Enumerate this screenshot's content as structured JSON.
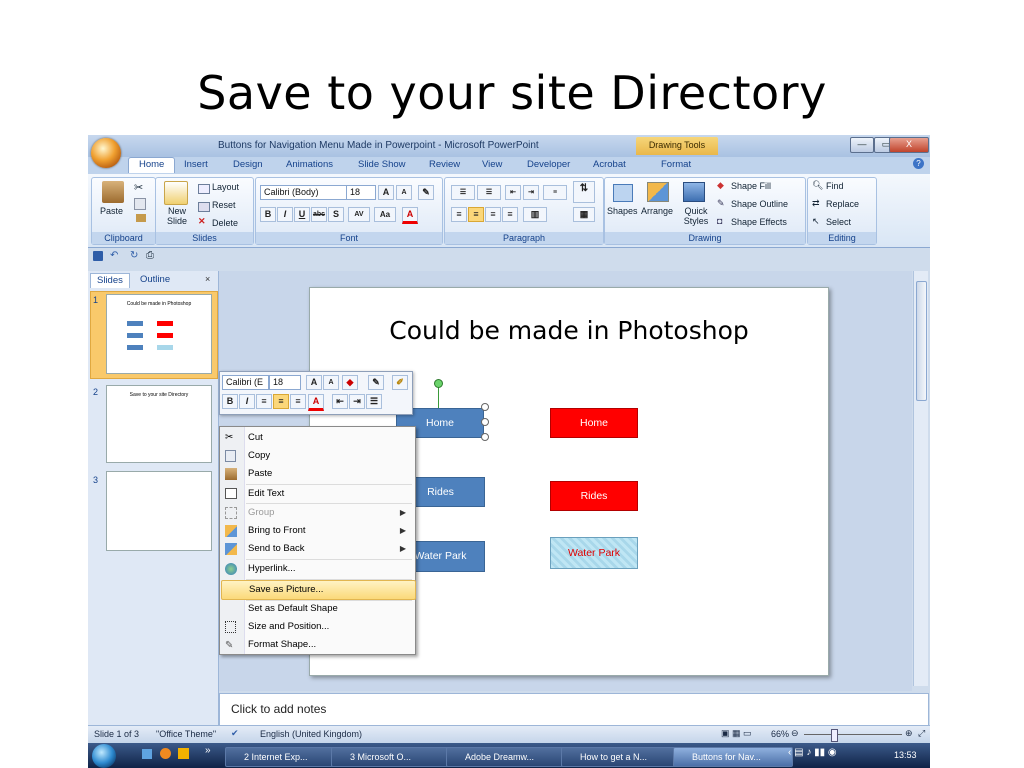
{
  "heading": "Save to your site Directory",
  "window": {
    "title": "Buttons for Navigation  Menu Made in Powerpoint - Microsoft PowerPoint",
    "contextual_tab": "Drawing Tools",
    "controls": [
      "—",
      "▭",
      "X"
    ]
  },
  "tabs": [
    "Home",
    "Insert",
    "Design",
    "Animations",
    "Slide Show",
    "Review",
    "View",
    "Developer",
    "Acrobat",
    "Format"
  ],
  "ribbon": {
    "clipboard": {
      "label": "Clipboard",
      "paste": "Paste"
    },
    "slides": {
      "label": "Slides",
      "new_slide": "New Slide",
      "layout": "Layout",
      "reset": "Reset",
      "delete": "Delete"
    },
    "font": {
      "label": "Font",
      "font_name": "Calibri (Body)",
      "font_size": "18"
    },
    "paragraph": {
      "label": "Paragraph"
    },
    "drawing": {
      "label": "Drawing",
      "shapes": "Shapes",
      "arrange": "Arrange",
      "quick_styles": "Quick Styles",
      "shape_fill": "Shape Fill",
      "shape_outline": "Shape Outline",
      "shape_effects": "Shape Effects"
    },
    "editing": {
      "label": "Editing",
      "find": "Find",
      "replace": "Replace",
      "select": "Select"
    }
  },
  "pane_tabs": [
    "Slides",
    "Outline"
  ],
  "thumbnails": [
    {
      "num": "1",
      "title": "Could be made in Photoshop"
    },
    {
      "num": "2",
      "title": "Save to your site Directory"
    },
    {
      "num": "3",
      "title": ""
    }
  ],
  "slide": {
    "title": "Could be made in Photoshop",
    "buttons_left": [
      "Home",
      "Rides",
      "Water Park"
    ],
    "buttons_right": [
      "Home",
      "Rides",
      "Water Park"
    ]
  },
  "mini_toolbar": {
    "font": "Calibri (E",
    "size": "18"
  },
  "context_menu": [
    {
      "label": "Cut",
      "enabled": true
    },
    {
      "label": "Copy",
      "enabled": true
    },
    {
      "label": "Paste",
      "enabled": true
    },
    {
      "label": "Edit Text",
      "enabled": true
    },
    {
      "label": "Group",
      "enabled": false
    },
    {
      "label": "Bring to Front",
      "enabled": true
    },
    {
      "label": "Send to Back",
      "enabled": true
    },
    {
      "label": "Hyperlink...",
      "enabled": true
    },
    {
      "label": "Save as Picture...",
      "enabled": true,
      "highlighted": true
    },
    {
      "label": "Set as Default Shape",
      "enabled": true
    },
    {
      "label": "Size and Position...",
      "enabled": true
    },
    {
      "label": "Format Shape...",
      "enabled": true
    }
  ],
  "notes_placeholder": "Click to add notes",
  "status": {
    "slide": "Slide 1 of 3",
    "theme": "\"Office Theme\"",
    "language": "English (United Kingdom)",
    "zoom": "66%"
  },
  "taskbar": {
    "items": [
      "2 Internet Exp...",
      "3 Microsoft O...",
      "Adobe Dreamw...",
      "How to get a N...",
      "Buttons for Nav..."
    ],
    "clock": "13:53"
  },
  "colors": {
    "accent_blue": "#4e81bd",
    "red": "#ff0000",
    "ribbon_blue": "#15428b"
  }
}
